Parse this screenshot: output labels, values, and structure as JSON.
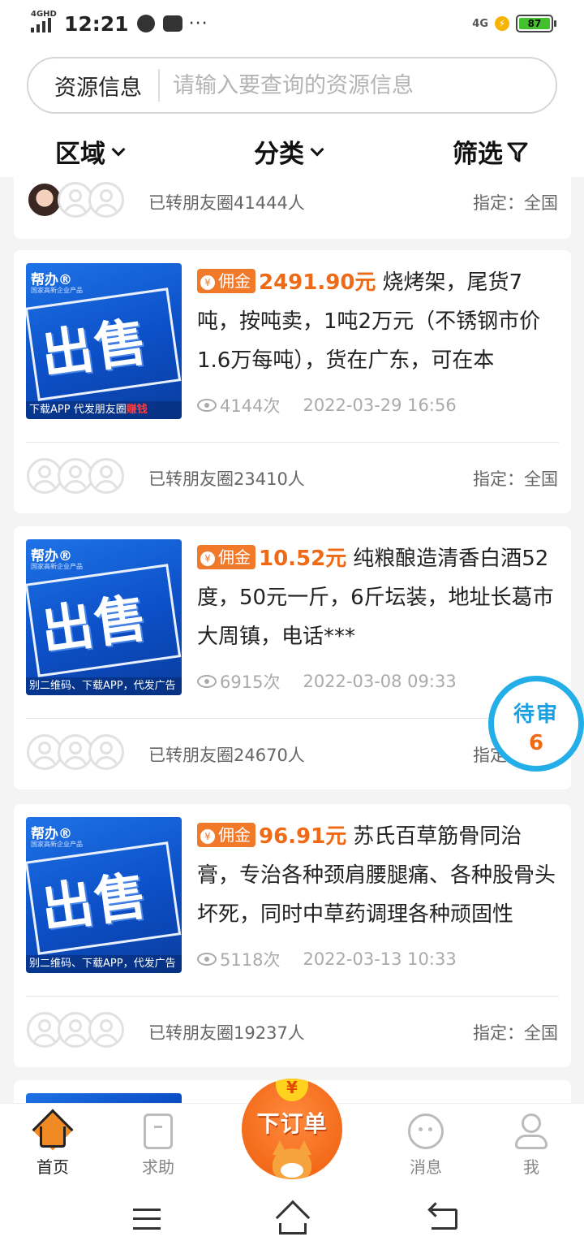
{
  "status_bar": {
    "network": "4GHD",
    "time": "12:21",
    "more": "···",
    "right_network": "4G",
    "battery": "87"
  },
  "search": {
    "category": "资源信息",
    "placeholder": "请输入要查询的资源信息"
  },
  "filters": {
    "region": "区域",
    "category": "分类",
    "screen": "筛选"
  },
  "top_card": {
    "shared_text": "已转朋友圈41444人",
    "region": "指定：全国"
  },
  "items": [
    {
      "img_brand": "帮办®",
      "img_brand_sub": "国家高新企业产品",
      "img_word": "出售",
      "img_foot": "下载APP  代发朋友圈",
      "img_foot_red": "赚钱",
      "badge": "佣金",
      "price": "2491.90元",
      "title": "烧烤架，尾货7吨，按吨卖，1吨2万元（不锈钢市价1.6万每吨），货在广东，可在本",
      "views": "4144次",
      "date": "2022-03-29 16:56",
      "shared_text": "已转朋友圈23410人",
      "region": "指定：全国"
    },
    {
      "img_brand": "帮办®",
      "img_brand_sub": "国家高新企业产品",
      "img_word": "出售",
      "img_foot": "别二维码、下载APP，代发广告",
      "img_foot_red": "",
      "badge": "佣金",
      "price": "10.52元",
      "title": "纯粮酿造清香白酒52度，50元一斤，6斤坛装，地址长葛市大周镇，电话***",
      "views": "6915次",
      "date": "2022-03-08 09:33",
      "shared_text": "已转朋友圈24670人",
      "region": "指定：全国"
    },
    {
      "img_brand": "帮办®",
      "img_brand_sub": "国家高新企业产品",
      "img_word": "出售",
      "img_foot": "别二维码、下载APP，代发广告",
      "img_foot_red": "",
      "badge": "佣金",
      "price": "96.91元",
      "title": "苏氏百草筋骨同治膏，专治各种颈肩腰腿痛、各种股骨头坏死，同时中草药调理各种顽固性",
      "views": "5118次",
      "date": "2022-03-13 10:33",
      "shared_text": "已转朋友圈19237人",
      "region": "指定：全国"
    }
  ],
  "pending": {
    "label": "待审",
    "count": "6"
  },
  "tabbar": {
    "home": "首页",
    "help": "求助",
    "order": "下订单",
    "order_yen": "¥",
    "messages": "消息",
    "me": "我"
  },
  "colors": {
    "accent": "#ef6a17",
    "badge": "#f07a2a",
    "pending_ring": "#23aee8",
    "image_blue": "#0c4fc7"
  }
}
